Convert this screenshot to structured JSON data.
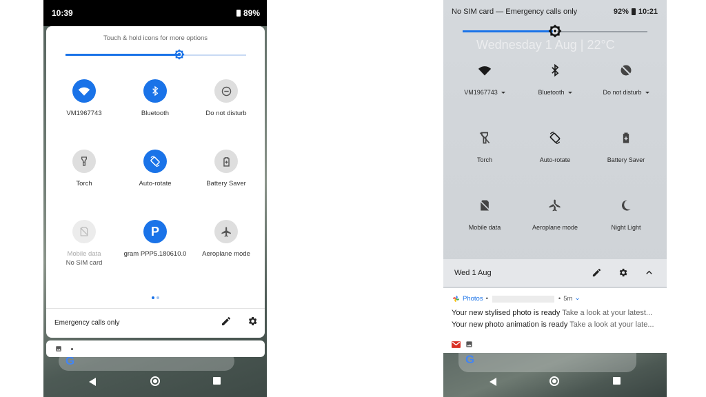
{
  "left_phone": {
    "status": {
      "time": "10:39",
      "battery": "89%"
    },
    "hint": "Touch & hold icons for more options",
    "brightness_level": 0.63,
    "tiles": [
      {
        "label": "VM1967743",
        "icon": "wifi-icon",
        "state": "on"
      },
      {
        "label": "Bluetooth",
        "icon": "bluetooth-icon",
        "state": "on"
      },
      {
        "label": "Do not disturb",
        "icon": "do-not-disturb-icon",
        "state": "off"
      },
      {
        "label": "Torch",
        "icon": "torch-icon",
        "state": "off"
      },
      {
        "label": "Auto-rotate",
        "icon": "auto-rotate-icon",
        "state": "on"
      },
      {
        "label": "Battery Saver",
        "icon": "battery-saver-icon",
        "state": "off"
      },
      {
        "label": "Mobile data",
        "sublabel": "No SIM card",
        "icon": "mobile-data-icon",
        "state": "disabled"
      },
      {
        "label": "gram PPP5.180610.0",
        "icon": "parking-icon",
        "state": "on"
      },
      {
        "label": "Aeroplane mode",
        "icon": "aeroplane-icon",
        "state": "off"
      }
    ],
    "footer_text": "Emergency calls only",
    "notification_dot": "•"
  },
  "right_phone": {
    "status": {
      "carrier": "No SIM card — Emergency calls only",
      "battery": "92%",
      "time": "10:21"
    },
    "ghost_date": "Wednesday 1 Aug  |  22°C",
    "brightness_level": 0.5,
    "tiles": [
      {
        "label": "VM1967743",
        "icon": "wifi-icon",
        "dropdown": true
      },
      {
        "label": "Bluetooth",
        "icon": "bluetooth-icon",
        "dropdown": true
      },
      {
        "label": "Do not disturb",
        "icon": "do-not-disturb-icon",
        "dropdown": true
      },
      {
        "label": "Torch",
        "icon": "torch-icon"
      },
      {
        "label": "Auto-rotate",
        "icon": "auto-rotate-icon"
      },
      {
        "label": "Battery Saver",
        "icon": "battery-saver-icon"
      },
      {
        "label": "Mobile data",
        "icon": "mobile-data-icon"
      },
      {
        "label": "Aeroplane mode",
        "icon": "aeroplane-icon"
      },
      {
        "label": "Night Light",
        "icon": "night-light-icon"
      }
    ],
    "date_bar": "Wed 1 Aug",
    "notification": {
      "app": "Photos",
      "age": "5m",
      "lines": [
        {
          "title": "Your new stylised photo is ready",
          "text": "Take a look at your latest..."
        },
        {
          "title": "Your new photo animation is ready",
          "text": "Take a look at your late..."
        }
      ]
    }
  },
  "colors": {
    "accent": "#1a73e8",
    "tile_off": "#dedede",
    "gmail": "#d93025"
  }
}
